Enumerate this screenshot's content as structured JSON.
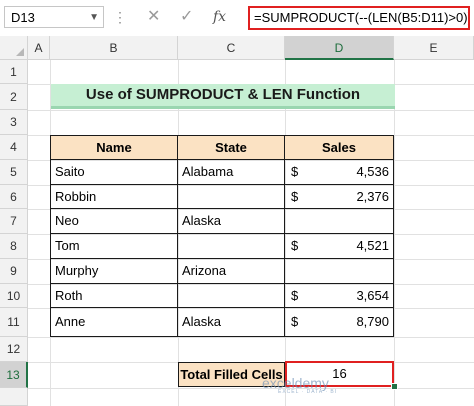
{
  "formula_bar": {
    "name_box": "D13",
    "formula": "=SUMPRODUCT(--(LEN(B5:D11)>0))"
  },
  "columns": [
    "A",
    "B",
    "C",
    "D",
    "E"
  ],
  "rows": [
    "1",
    "2",
    "3",
    "4",
    "5",
    "6",
    "7",
    "8",
    "9",
    "10",
    "11",
    "12",
    "13"
  ],
  "sheet": {
    "title": "Use of SUMPRODUCT & LEN Function",
    "table": {
      "headers": [
        "Name",
        "State",
        "Sales"
      ],
      "rows": [
        {
          "name": "Saito",
          "state": "Alabama",
          "currency": "$",
          "sales": "4,536"
        },
        {
          "name": "Robbin",
          "state": "",
          "currency": "$",
          "sales": "2,376"
        },
        {
          "name": "Neo",
          "state": "Alaska",
          "currency": "",
          "sales": ""
        },
        {
          "name": "Tom",
          "state": "",
          "currency": "$",
          "sales": "4,521"
        },
        {
          "name": "Murphy",
          "state": "Arizona",
          "currency": "",
          "sales": ""
        },
        {
          "name": "Roth",
          "state": "",
          "currency": "$",
          "sales": "3,654"
        },
        {
          "name": "Anne",
          "state": "Alaska",
          "currency": "$",
          "sales": "8,790"
        }
      ]
    },
    "total_label": "Total Filled Cells",
    "total_value": "16"
  },
  "watermark": {
    "brand": "exceldemy",
    "tagline": "EXCEL · DATA · BI"
  },
  "colors": {
    "accent": "#217346",
    "highlight": "#e02020",
    "title_fill": "#c6efd3",
    "header_fill": "#fbe2c3"
  }
}
